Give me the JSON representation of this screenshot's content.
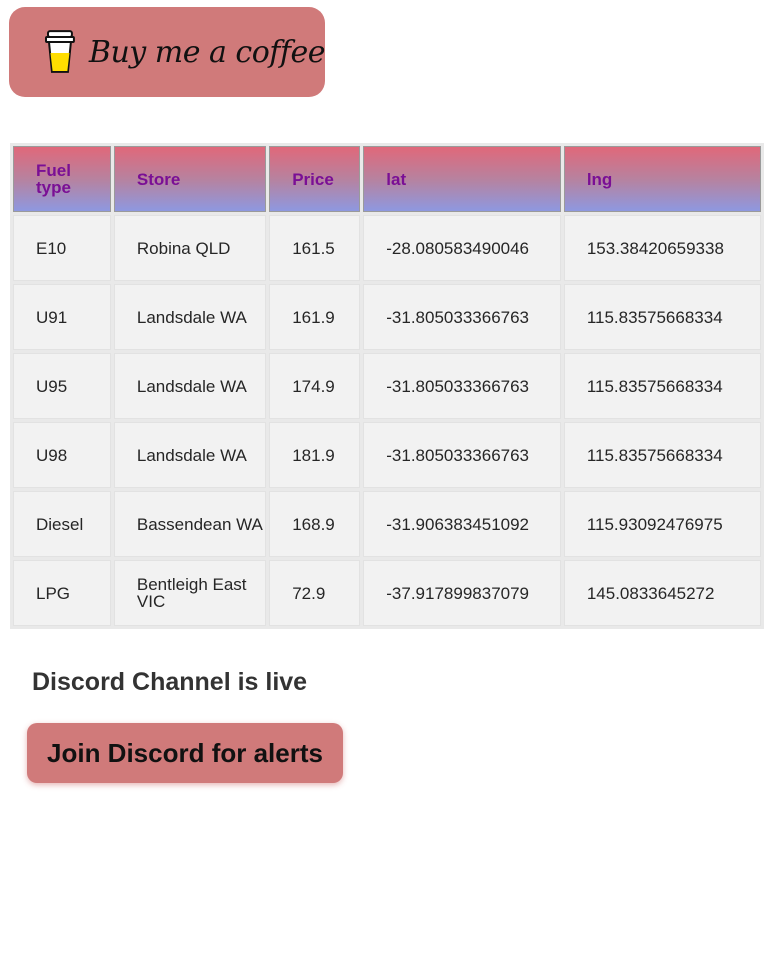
{
  "coffee_button": {
    "label": "Buy me a coffee",
    "icon": "coffee-cup-icon"
  },
  "table": {
    "headers": [
      "Fuel type",
      "Store",
      "Price",
      "lat",
      "lng"
    ],
    "rows": [
      [
        "E10",
        "Robina QLD",
        "161.5",
        "-28.080583490046",
        "153.38420659338"
      ],
      [
        "U91",
        "Landsdale WA",
        "161.9",
        "-31.805033366763",
        "115.83575668334"
      ],
      [
        "U95",
        "Landsdale WA",
        "174.9",
        "-31.805033366763",
        "115.83575668334"
      ],
      [
        "U98",
        "Landsdale WA",
        "181.9",
        "-31.805033366763",
        "115.83575668334"
      ],
      [
        "Diesel",
        "Bassendean WA",
        "168.9",
        "-31.906383451092",
        "115.93092476975"
      ],
      [
        "LPG",
        "Bentleigh East VIC",
        "72.9",
        "-37.917899837079",
        "145.0833645272"
      ]
    ]
  },
  "discord": {
    "heading": "Discord Channel is live",
    "button_label": "Join Discord for alerts"
  },
  "colors": {
    "button_bg": "#d07a7a",
    "header_text": "#7a0f95",
    "header_gradient_top": "#e0687a",
    "header_gradient_bottom": "#8e98e0"
  }
}
